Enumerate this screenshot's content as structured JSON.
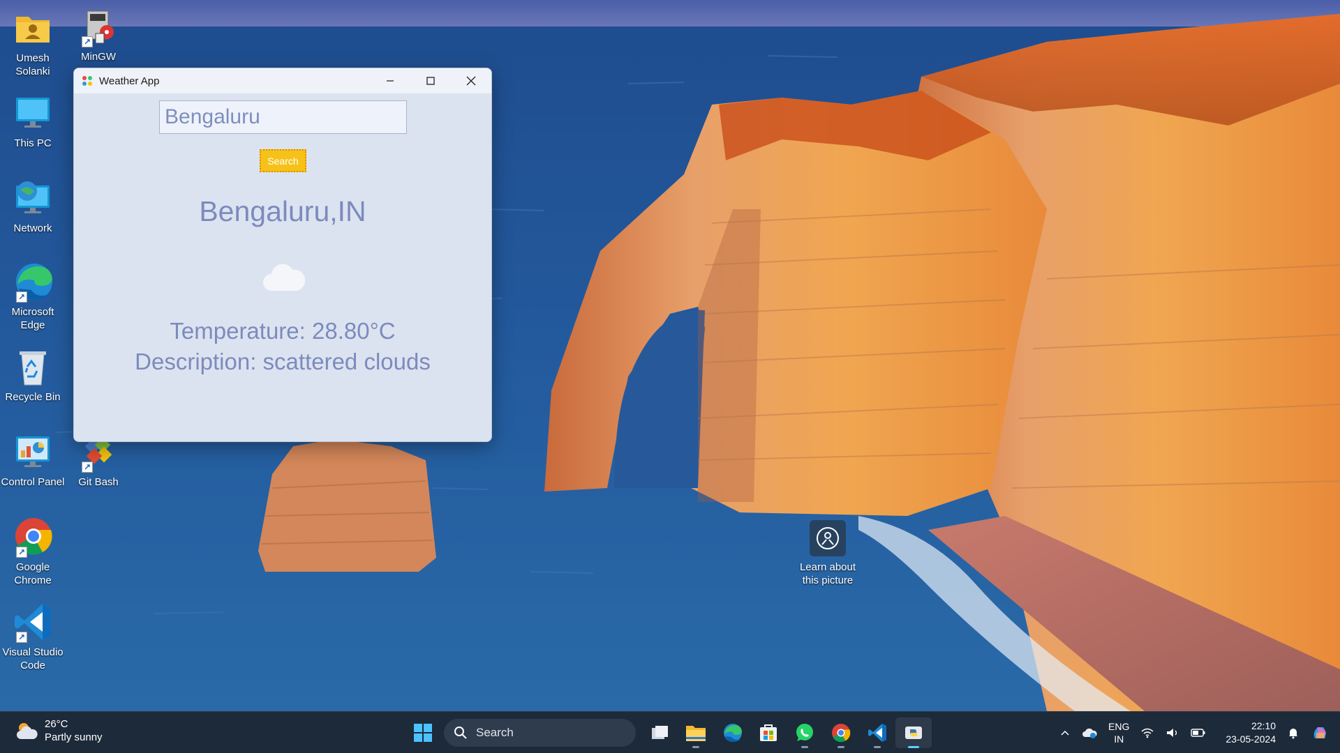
{
  "desktop": {
    "icons": [
      {
        "label": "Umesh\nSolanki",
        "icon": "user-folder-icon"
      },
      {
        "label": "MinGW",
        "icon": "mingw-installer-icon"
      },
      {
        "label": "This PC",
        "icon": "monitor-icon"
      },
      {
        "label": "Network",
        "icon": "network-globe-icon"
      },
      {
        "label": "Microsoft\nEdge",
        "icon": "edge-icon"
      },
      {
        "label": "Recycle Bin",
        "icon": "recycle-bin-icon"
      },
      {
        "label": "Control Panel",
        "icon": "control-panel-icon"
      },
      {
        "label": "Git Bash",
        "icon": "git-bash-icon"
      },
      {
        "label": "Google\nChrome",
        "icon": "chrome-icon"
      },
      {
        "label": "Visual Studio\nCode",
        "icon": "vscode-icon"
      }
    ],
    "learn_about": "Learn about\nthis picture"
  },
  "window": {
    "title": "Weather App",
    "city_input_value": "Bengaluru",
    "search_label": "Search",
    "city_name": "Bengaluru,IN",
    "weather_icon": "cloud-icon",
    "temperature_text": "Temperature: 28.80°C",
    "description_text": "Description: scattered clouds"
  },
  "taskbar": {
    "weather_temp": "26°C",
    "weather_desc": "Partly sunny",
    "search_label": "Search",
    "apps": [
      "start-icon",
      "search-icon",
      "task-view-icon",
      "file-explorer-icon",
      "edge-icon",
      "store-icon",
      "whatsapp-icon",
      "chrome-icon",
      "vscode-icon",
      "python-icon"
    ],
    "lang_line1": "ENG",
    "lang_line2": "IN",
    "time": "22:10",
    "date": "23-05-2024"
  },
  "colors": {
    "window_bg": "#dce3f0",
    "text_accent": "#7c8bbd",
    "search_button": "#f6c21a",
    "taskbar_bg": "#1d2a3a"
  }
}
